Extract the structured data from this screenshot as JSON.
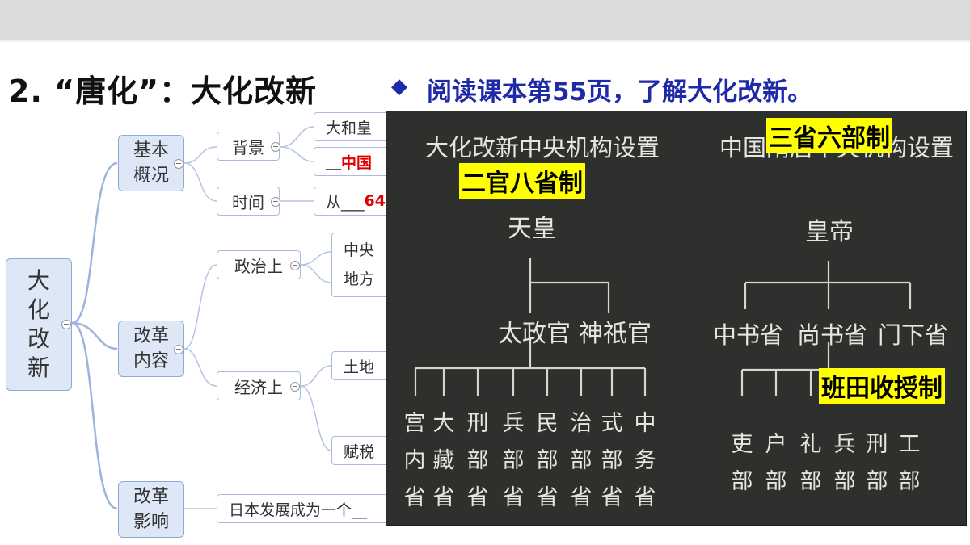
{
  "title": "2. “唐化”：大化改新",
  "instruction": {
    "bullet": "◆",
    "text": "阅读课本第55页，了解大化改新。"
  },
  "mindmap": {
    "root": [
      "大",
      "化",
      "改",
      "新"
    ],
    "categories": [
      {
        "label": [
          "基本",
          "概况"
        ]
      },
      {
        "label": [
          "改革",
          "内容"
        ]
      },
      {
        "label": [
          "改革",
          "影响"
        ]
      }
    ],
    "subs": {
      "background": "背景",
      "time": "时间",
      "politics": "政治上",
      "economy": "经济上"
    },
    "leaves": {
      "bg1": "大和皇",
      "bg2_prefix": "__",
      "bg2_red": "中国",
      "time_prefix": "从___",
      "time_red": "64",
      "central": "中央",
      "local": "地方",
      "land": "土地",
      "tax": "赋税",
      "impact": "日本发展成为一个__"
    }
  },
  "slide": {
    "left_title": "大化改新中央机构设置",
    "right_title": "中国隋唐中央机构设置",
    "highlight_left": "二官八省制",
    "highlight_right": "三省六部制",
    "highlight_land": "班田收授制",
    "left_top": "天皇",
    "left_mid": [
      "太政官",
      "神祇官"
    ],
    "left_bottom": [
      [
        "宫",
        "内",
        "省"
      ],
      [
        "大",
        "藏",
        "省"
      ],
      [
        "刑",
        "部",
        "省"
      ],
      [
        "兵",
        "部",
        "省"
      ],
      [
        "民",
        "部",
        "省"
      ],
      [
        "治",
        "部",
        "省"
      ],
      [
        "式",
        "部",
        "省"
      ],
      [
        "中",
        "务",
        "省"
      ]
    ],
    "right_top": "皇帝",
    "right_mid": [
      "中书省",
      "尚书省",
      "门下省"
    ],
    "right_bottom": [
      [
        "吏",
        "部"
      ],
      [
        "户",
        "部"
      ],
      [
        "礼",
        "部"
      ],
      [
        "兵",
        "部"
      ],
      [
        "刑",
        "部"
      ],
      [
        "工",
        "部"
      ]
    ]
  }
}
